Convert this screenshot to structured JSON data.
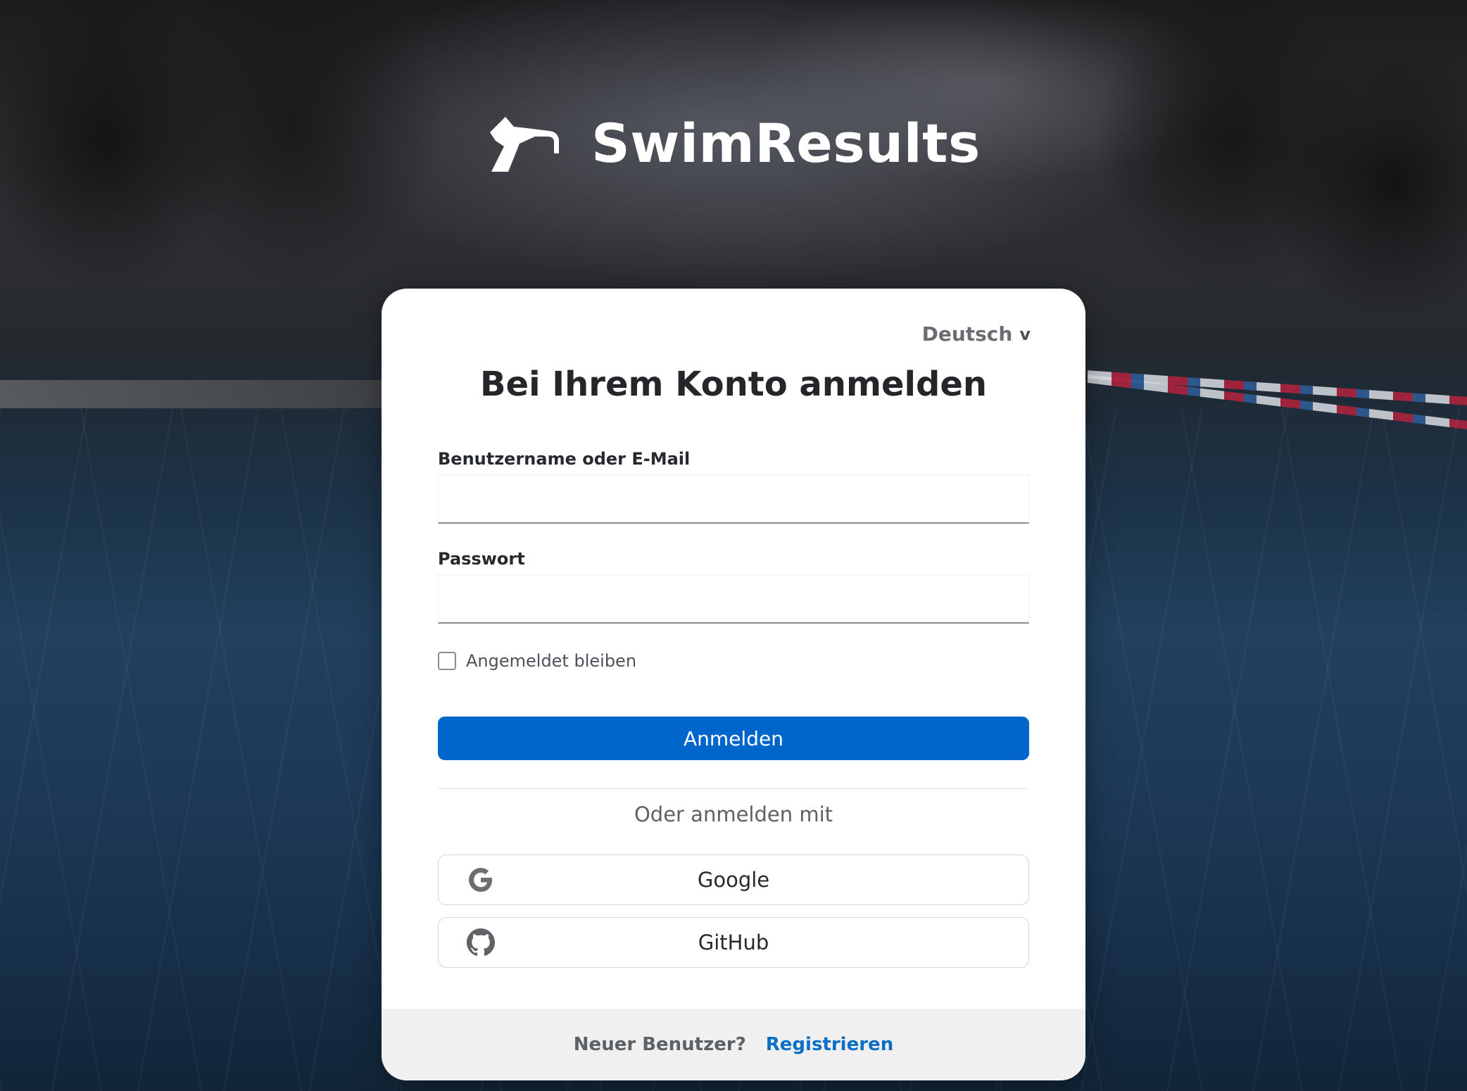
{
  "brand": {
    "name": "SwimResults",
    "logo_icon": "swimmer-dive-icon"
  },
  "login": {
    "language": "Deutsch",
    "language_chevron": "v",
    "title": "Bei Ihrem Konto anmelden",
    "username_label": "Benutzername oder E-Mail",
    "username_value": "",
    "password_label": "Passwort",
    "password_value": "",
    "remember_label": "Angemeldet bleiben",
    "remember_checked": false,
    "submit_label": "Anmelden",
    "or_text": "Oder anmelden mit",
    "providers": [
      {
        "label": "Google",
        "icon": "google-icon"
      },
      {
        "label": "GitHub",
        "icon": "github-icon"
      }
    ],
    "footer_text": "Neuer Benutzer?",
    "register_label": "Registrieren"
  },
  "colors": {
    "primary": "#0066cc",
    "link": "#0b6fc5",
    "card_bg": "#ffffff",
    "footer_bg": "#f0f0f0"
  }
}
